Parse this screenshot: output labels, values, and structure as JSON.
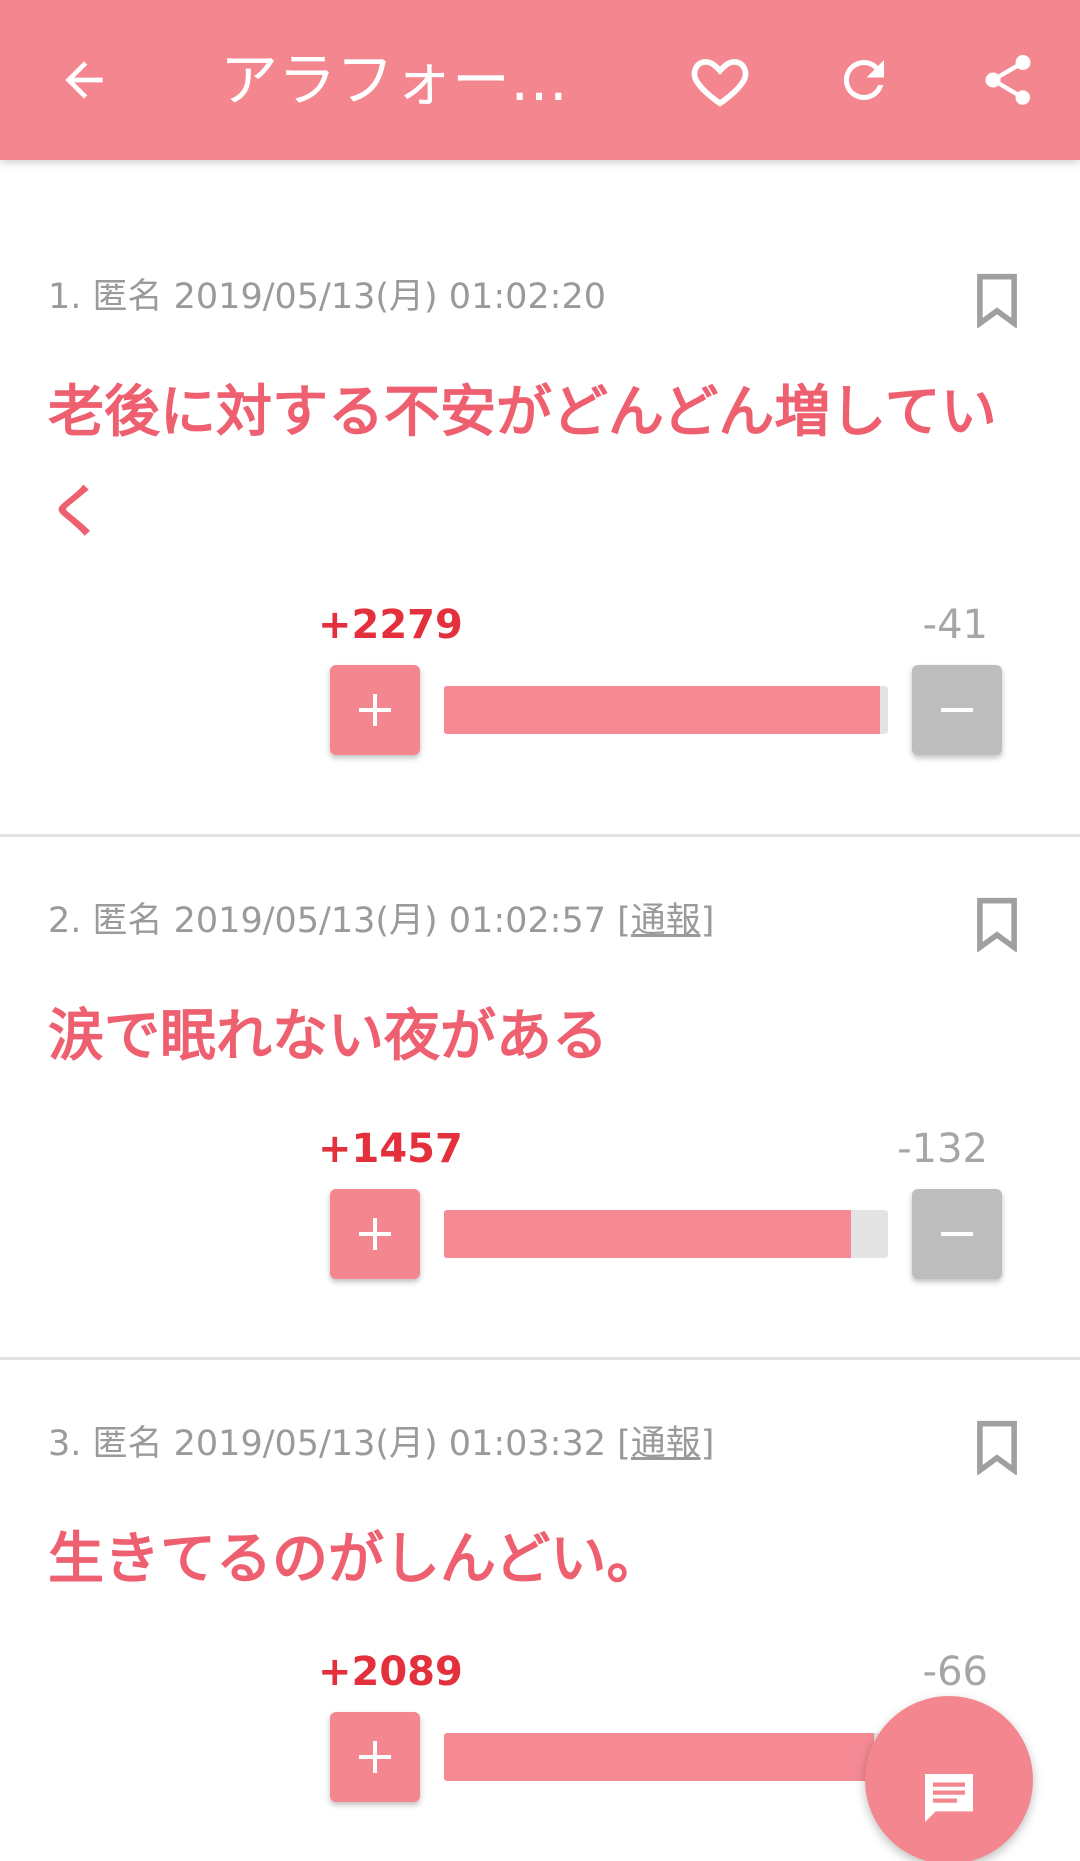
{
  "appbar": {
    "title": "アラフォー独…",
    "icons": [
      "back-arrow-icon",
      "heart-icon",
      "refresh-icon",
      "share-icon"
    ]
  },
  "colors": {
    "accent": "#f4868f",
    "plus": "#e3303c",
    "text": "#ee5f70"
  },
  "posts": [
    {
      "meta": "1. 匿名 2019/05/13(月) 01:02:20",
      "report": "",
      "text": "老後に対する不安がどんどん増していく",
      "plus": "+2279",
      "minus": "-41",
      "ratio": 0.982
    },
    {
      "meta": "2. 匿名 2019/05/13(月) 01:02:57 ",
      "report": "[通報]",
      "text": "涙で眠れない夜がある",
      "plus": "+1457",
      "minus": "-132",
      "ratio": 0.917
    },
    {
      "meta": "3. 匿名 2019/05/13(月) 01:03:32 ",
      "report": "[通報]",
      "text": "生きてるのがしんどい。",
      "plus": "+2089",
      "minus": "-66",
      "ratio": 0.969
    }
  ],
  "fab": {
    "icon": "comment-icon"
  }
}
